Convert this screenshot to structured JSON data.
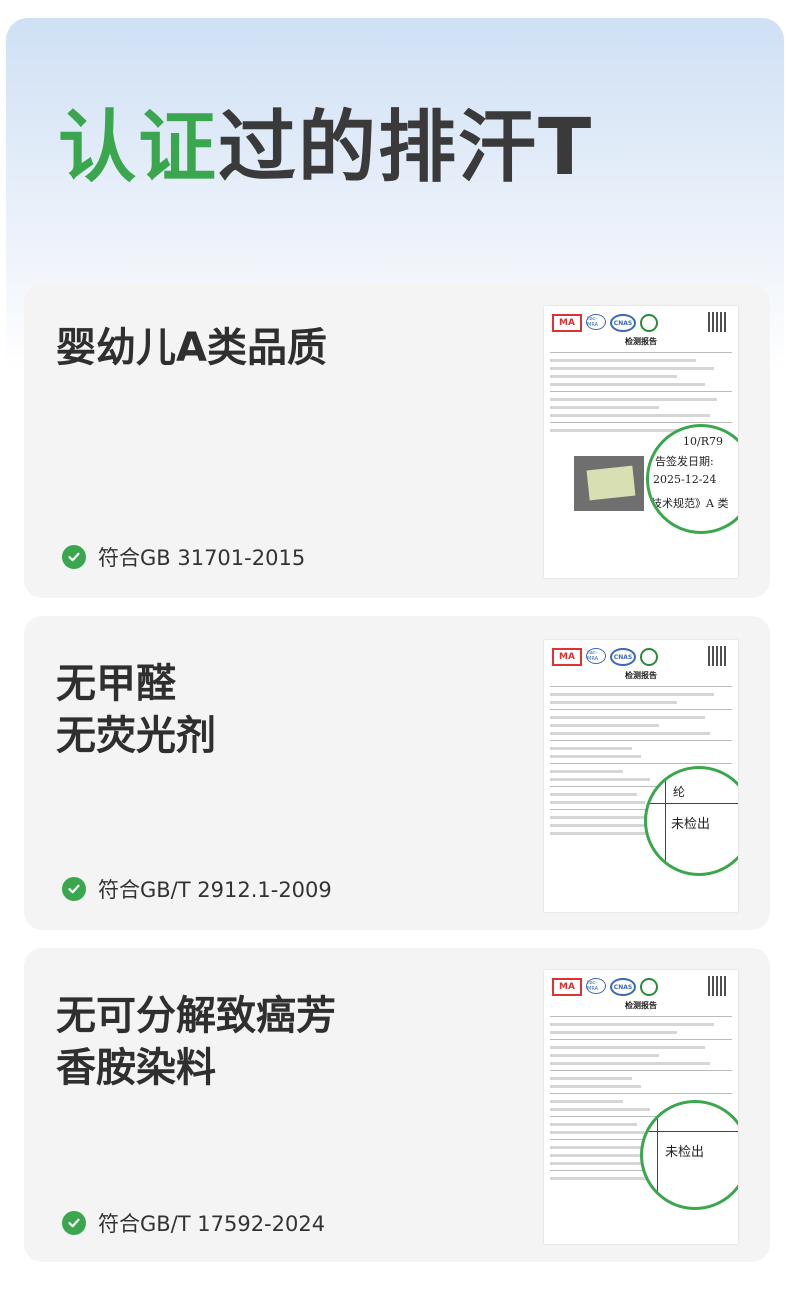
{
  "title": {
    "accent": "认证",
    "rest": "过的排汗T"
  },
  "cards": [
    {
      "heading_lines": [
        "婴幼儿A类品质"
      ],
      "cert_text": "符合GB 31701-2015",
      "doc": {
        "header": "检测报告",
        "zoom_lines": [
          "10/R79",
          "告签发日期:",
          "2025-12-24",
          "技术规范》A 类"
        ]
      }
    },
    {
      "heading_lines": [
        "无甲醛",
        "无荧光剂"
      ],
      "cert_text": "符合GB/T 2912.1-2009",
      "doc": {
        "header": "检测报告",
        "zoom_lines": [
          "纶",
          "未检出"
        ]
      }
    },
    {
      "heading_lines": [
        "无可分解致癌芳",
        "香胺染料"
      ],
      "cert_text": "符合GB/T 17592-2024",
      "doc": {
        "header": "检测报告",
        "zoom_lines": [
          "未检出"
        ]
      }
    }
  ],
  "logos": {
    "ma": "MA",
    "ilac": "ilac-MRA",
    "cnas": "CNAS"
  },
  "colors": {
    "accent": "#3aa64d",
    "card_bg": "#f4f4f4",
    "text": "#2f2f2f"
  },
  "icons": {
    "check": "check-circle-icon"
  }
}
